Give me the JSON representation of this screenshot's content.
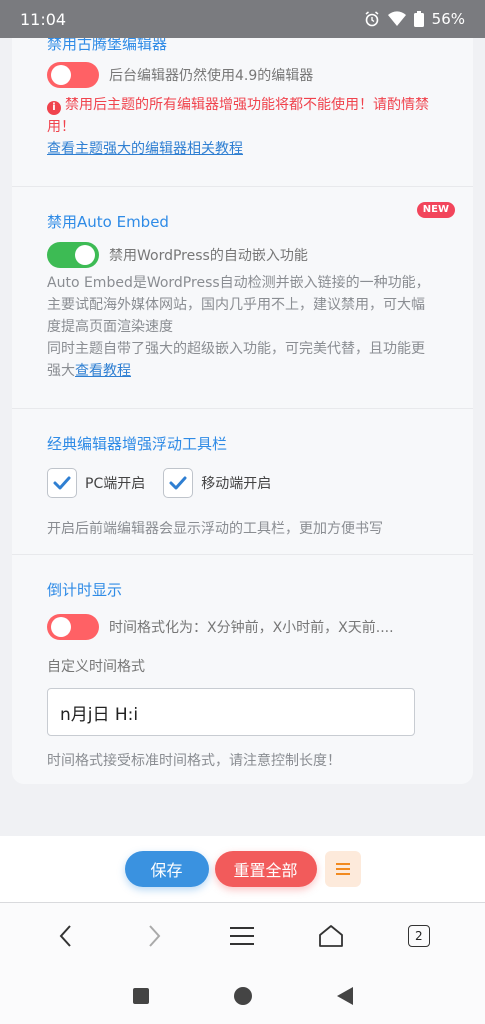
{
  "status": {
    "time": "11:04",
    "battery": "56%"
  },
  "gutenberg": {
    "title": "禁用古腾堡编辑器",
    "toggle_label": "后台编辑器仍然使用4.9的编辑器",
    "warning": "禁用后主题的所有编辑器增强功能将都不能使用！请酌情禁用！",
    "link": "查看主题强大的编辑器相关教程"
  },
  "auto_embed": {
    "badge": "NEW",
    "title": "禁用Auto Embed",
    "toggle_label": "禁用WordPress的自动嵌入功能",
    "desc_line1": "Auto Embed是WordPress自动检测并嵌入链接的一种功能，主要试配海外媒体网站，国内几乎用不上，建议禁用，可大幅度提高页面渲染速度",
    "desc_line2": "同时主题自带了强大的超级嵌入功能，可完美代替，且功能更强大",
    "link": "查看教程"
  },
  "toolbar": {
    "title": "经典编辑器增强浮动工具栏",
    "pc_label": "PC端开启",
    "mobile_label": "移动端开启",
    "desc": "开启后前端编辑器会显示浮动的工具栏，更加方便书写"
  },
  "countdown": {
    "title": "倒计时显示",
    "toggle_label": "时间格式化为：X分钟前，X小时前，X天前....",
    "field_label": "自定义时间格式",
    "field_value": "n月j日 H:i",
    "hint": "时间格式接受标准时间格式，请注意控制长度！"
  },
  "actions": {
    "save": "保存",
    "reset": "重置全部"
  },
  "browser": {
    "tab_count": "2"
  },
  "colors": {
    "accent": "#2f8be6",
    "danger": "#f0434d",
    "success": "#3dbb54"
  }
}
